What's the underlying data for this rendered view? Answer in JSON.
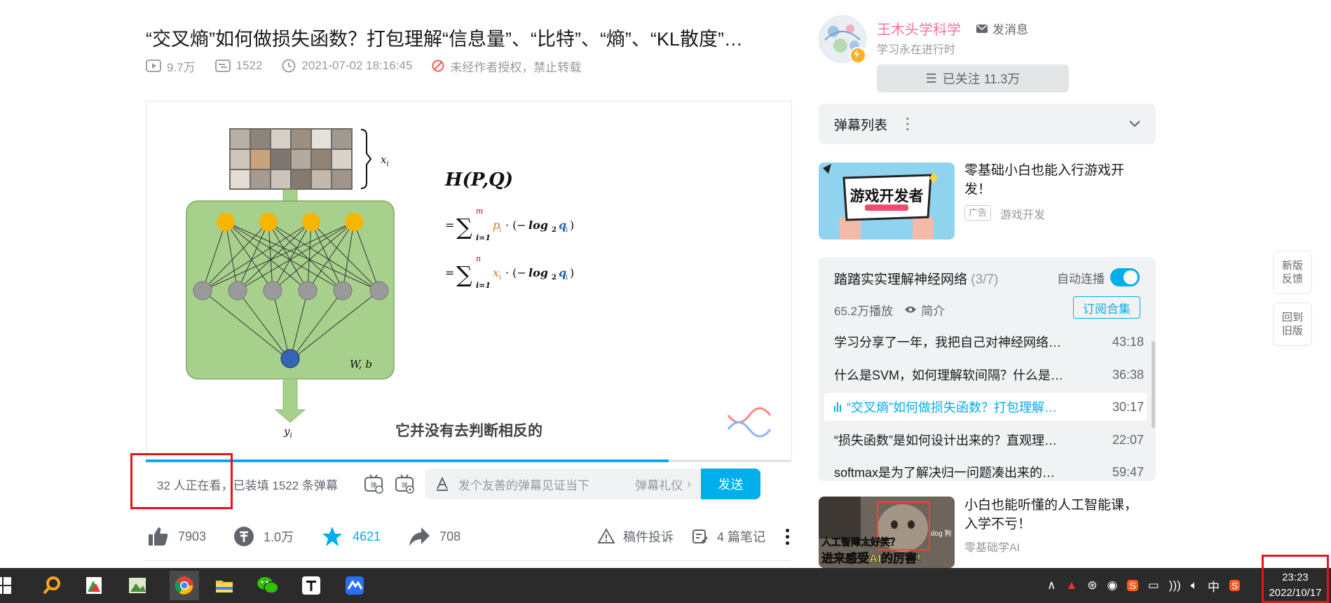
{
  "video": {
    "title": "“交叉熵”如何做损失函数？打包理解“信息量”、“比特”、“熵”、“KL散度”…",
    "views": "9.7万",
    "danmaku_count": "1522",
    "date": "2021-07-02 18:16:45",
    "copyright": "未经作者授权，禁止转载"
  },
  "player": {
    "subtitle": "它并没有去判断相反的",
    "formula_title": "H(P,Q)",
    "label_x": "x",
    "label_x_sub": "i",
    "label_wb": "W, b",
    "label_y": "y",
    "label_y_sub": "i",
    "progress": 0.81
  },
  "sendbar": {
    "watching": "32 人正在看，",
    "loaded": "已装填 1522 条弹幕",
    "placeholder": "发个友善的弹幕见证当下",
    "etiquette": "弹幕礼仪",
    "send": "发送"
  },
  "toolbar": {
    "like": "7903",
    "coin": "1.0万",
    "favorite": "4621",
    "share": "708",
    "report": "稿件投诉",
    "notes": "4 篇笔记"
  },
  "uploader": {
    "name": "王木头学科学",
    "message": "发消息",
    "signature": "学习永在进行时",
    "follow": "已关注 11.3万"
  },
  "danmaku_list": {
    "label": "弹幕列表"
  },
  "ad": {
    "thumb_text": "游戏开发者",
    "title": "零基础小白也能入行游戏开发！",
    "tag": "广告",
    "source": "游戏开发"
  },
  "playlist": {
    "title": "踏踏实实理解神经网络",
    "count": "(3/7)",
    "autoplay": "自动连播",
    "plays": "65.2万播放",
    "intro": "简介",
    "subscribe": "订阅合集",
    "episodes": [
      {
        "title": "学习分享了一年，我把自己对神经网络…",
        "duration": "43:18"
      },
      {
        "title": "什么是SVM，如何理解软间隔？什么是…",
        "duration": "36:38"
      },
      {
        "title": "“交叉熵”如何做损失函数？打包理解…",
        "duration": "30:17"
      },
      {
        "title": "“损失函数”是如何设计出来的？直观理…",
        "duration": "22:07"
      },
      {
        "title": "softmax是为了解决归一问题凑出来的…",
        "duration": "59:47"
      }
    ]
  },
  "recommend": {
    "title": "小白也能听懂的人工智能课，入学不亏！",
    "source": "零基础学AI",
    "thumb_line1": "人工智障太好笑？",
    "thumb_line2": "进来感受AI的厉害!",
    "thumb_dog": "dog 狗"
  },
  "side": {
    "feedback": "新版反馈",
    "old": "回到旧版"
  },
  "taskbar": {
    "ime": "中",
    "time": "23:23",
    "date": "2022/10/17"
  },
  "colors": {
    "accent": "#00aeec",
    "pink": "#fb7299",
    "highlight_box": "#e8141a"
  }
}
